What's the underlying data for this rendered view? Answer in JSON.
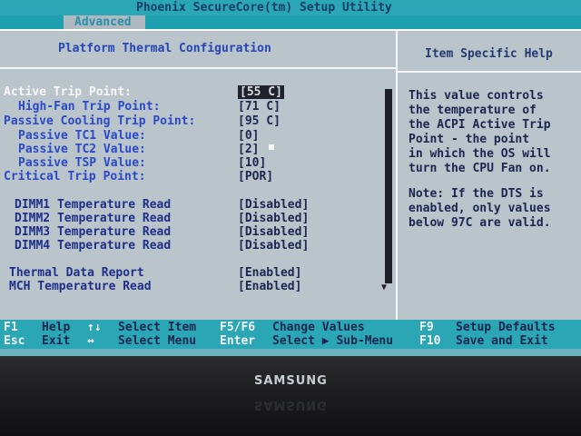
{
  "window": {
    "title": "Phoenix SecureCore(tm) Setup Utility",
    "active_tab": "Advanced"
  },
  "page": {
    "section_title": "Platform Thermal Configuration"
  },
  "settings": [
    {
      "label": "Active Trip Point:",
      "value": "[55 C]"
    },
    {
      "label": "High-Fan Trip Point:",
      "value": "[71 C]"
    },
    {
      "label": "Passive Cooling Trip Point:",
      "value": "[95 C]"
    },
    {
      "label": "Passive TC1 Value:",
      "value": "[0]"
    },
    {
      "label": "Passive TC2 Value:",
      "value": "[2]"
    },
    {
      "label": "Passive TSP Value:",
      "value": "[10]"
    },
    {
      "label": "Critical Trip Point:",
      "value": "[POR]"
    },
    {
      "label": "DIMM1 Temperature Read",
      "value": "[Disabled]"
    },
    {
      "label": "DIMM2 Temperature Read",
      "value": "[Disabled]"
    },
    {
      "label": "DIMM3 Temperature Read",
      "value": "[Disabled]"
    },
    {
      "label": "DIMM4 Temperature Read",
      "value": "[Disabled]"
    },
    {
      "label": "Thermal Data Report",
      "value": "[Enabled]"
    },
    {
      "label": "MCH Temperature Read",
      "value": "[Enabled]"
    }
  ],
  "help": {
    "title": "Item Specific Help",
    "lines": [
      "This value controls",
      "the temperature of",
      "the ACPI Active Trip",
      "Point - the point",
      "in which the OS will",
      "turn the CPU Fan on.",
      "",
      "Note: If the DTS is",
      "enabled, only values",
      "below 97C are valid."
    ]
  },
  "footer": {
    "row1": [
      {
        "key": "F1",
        "desc": "Help"
      },
      {
        "key": "↑↓",
        "desc": "Select Item"
      },
      {
        "key": "F5/F6",
        "desc": "Change Values"
      },
      {
        "key": "F9",
        "desc": "Setup Defaults"
      }
    ],
    "row2": [
      {
        "key": "Esc",
        "desc": "Exit"
      },
      {
        "key": "↔",
        "desc": "Select Menu"
      },
      {
        "key": "Enter",
        "desc": "Select ▶ Sub-Menu"
      },
      {
        "key": "F10",
        "desc": "Save and Exit"
      }
    ]
  },
  "monitor": {
    "brand": "SAMSUNG"
  }
}
